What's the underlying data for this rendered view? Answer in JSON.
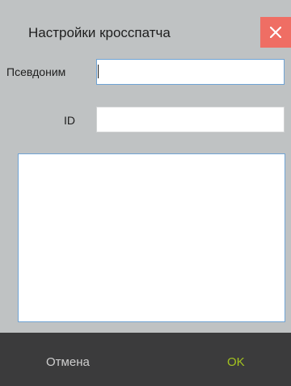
{
  "dialog": {
    "title": "Настройки кросспатча",
    "close_label": "×"
  },
  "form": {
    "alias_label": "Псевдоним",
    "alias_value": "",
    "id_label": "ID",
    "id_value": "",
    "notes_value": ""
  },
  "footer": {
    "cancel_label": "Отмена",
    "ok_label": "OK"
  },
  "colors": {
    "close_bg": "#ef6e64",
    "footer_bg": "#3b3b3c",
    "ok_text": "#a3c31f",
    "focus_border": "#6fa3d4"
  }
}
